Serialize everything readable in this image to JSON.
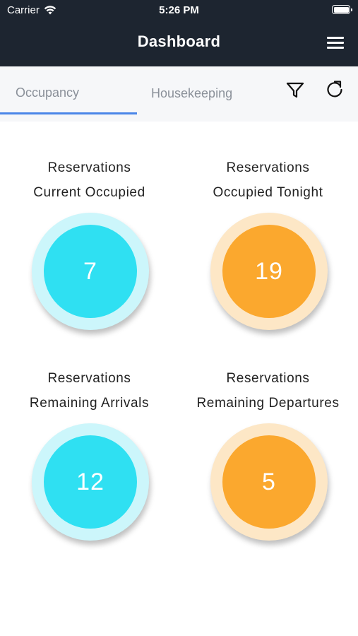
{
  "status_bar": {
    "carrier": "Carrier",
    "time": "5:26 PM"
  },
  "header": {
    "title": "Dashboard"
  },
  "tabs": [
    {
      "label": "Occupancy",
      "selected": true
    },
    {
      "label": "Housekeeping",
      "selected": false
    }
  ],
  "colors": {
    "header_bg": "#1d2530",
    "tab_indicator": "#4a86e8",
    "cyan": "#2fe0f2",
    "orange": "#fba82e"
  },
  "cards": [
    {
      "line1": "Reservations",
      "line2": "Current Occupied",
      "value": "7",
      "color": "cyan"
    },
    {
      "line1": "Reservations",
      "line2": "Occupied Tonight",
      "value": "19",
      "color": "orange"
    },
    {
      "line1": "Reservations",
      "line2": "Remaining Arrivals",
      "value": "12",
      "color": "cyan"
    },
    {
      "line1": "Reservations",
      "line2": "Remaining Departures",
      "value": "5",
      "color": "orange"
    }
  ]
}
